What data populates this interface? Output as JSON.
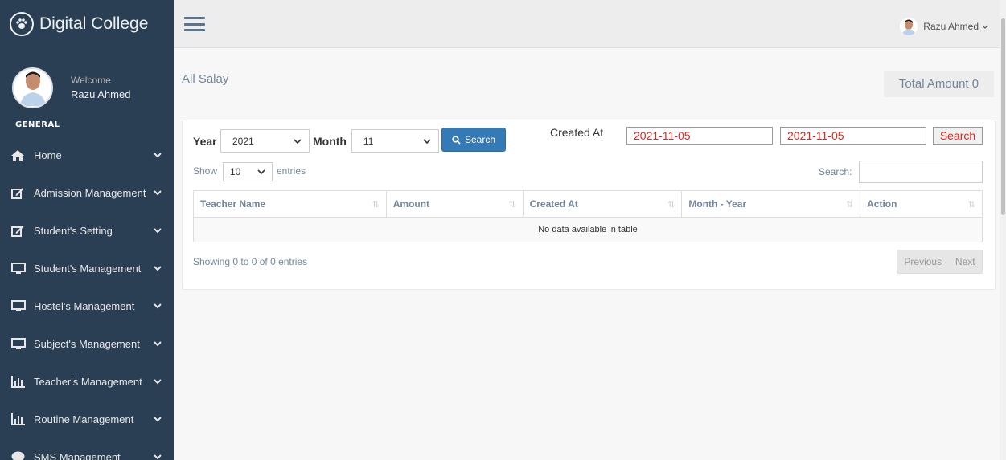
{
  "sidebar": {
    "brand": "Digital College",
    "profile": {
      "welcome": "Welcome",
      "name": "Razu Ahmed"
    },
    "section": "GENERAL",
    "items": [
      {
        "label": "Home",
        "icon": "home-icon"
      },
      {
        "label": "Admission Management",
        "icon": "edit-icon"
      },
      {
        "label": "Student's Setting",
        "icon": "edit-icon"
      },
      {
        "label": "Student's Management",
        "icon": "desktop-icon"
      },
      {
        "label": "Hostel's Management",
        "icon": "desktop-icon"
      },
      {
        "label": "Subject's Management",
        "icon": "desktop-icon"
      },
      {
        "label": "Teacher's Management",
        "icon": "bar-chart-icon"
      },
      {
        "label": "Routine Management",
        "icon": "bar-chart-icon"
      },
      {
        "label": "SMS Management",
        "icon": "comment-icon"
      }
    ]
  },
  "topnav": {
    "user_name": "Razu Ahmed"
  },
  "main": {
    "title": "All Salay",
    "total_amount": "Total Amount 0",
    "filters": {
      "year_label": "Year",
      "year_value": "2021",
      "month_label": "Month",
      "month_value": "11",
      "search_button": "Search",
      "created_at_label": "Created At",
      "date_from": "2021-11-05",
      "date_to": "2021-11-05",
      "date_search_button": "Search"
    },
    "table": {
      "show_label": "Show",
      "entries_value": "10",
      "entries_label": "entries",
      "search_label": "Search:",
      "columns": [
        "Teacher Name",
        "Amount",
        "Created At",
        "Month - Year",
        "Action"
      ],
      "empty_message": "No data available in table",
      "info": "Showing 0 to 0 of 0 entries",
      "previous": "Previous",
      "next": "Next"
    }
  },
  "colors": {
    "sidebar_bg": "#2a3f54",
    "primary_button": "#337ab7",
    "date_text": "#e2261b"
  }
}
